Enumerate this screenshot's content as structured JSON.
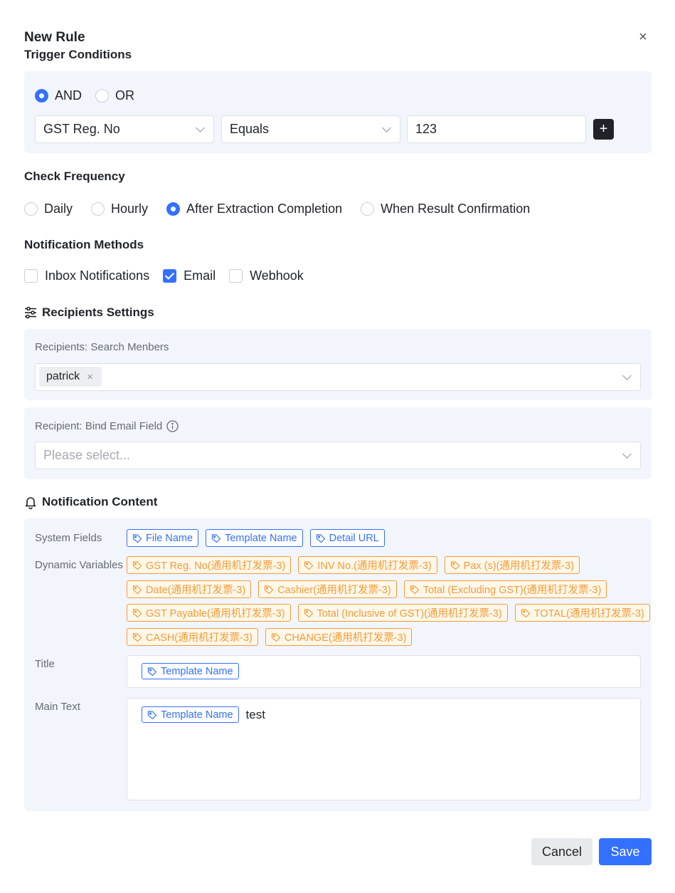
{
  "dialog": {
    "title": "New Rule",
    "close_glyph": "×"
  },
  "trigger": {
    "heading": "Trigger Conditions",
    "logic": [
      {
        "label": "AND",
        "checked": true
      },
      {
        "label": "OR",
        "checked": false
      }
    ],
    "field_value": "GST Reg. No",
    "operator_value": "Equals",
    "input_value": "123",
    "add_glyph": "+"
  },
  "frequency": {
    "heading": "Check Frequency",
    "options": [
      {
        "label": "Daily",
        "checked": false
      },
      {
        "label": "Hourly",
        "checked": false
      },
      {
        "label": "After Extraction Completion",
        "checked": true
      },
      {
        "label": "When Result Confirmation",
        "checked": false
      }
    ]
  },
  "methods": {
    "heading": "Notification Methods",
    "options": [
      {
        "label": "Inbox Notifications",
        "checked": false
      },
      {
        "label": "Email",
        "checked": true
      },
      {
        "label": "Webhook",
        "checked": false
      }
    ]
  },
  "recipients": {
    "heading": "Recipients Settings",
    "search_label": "Recipients: Search Menbers",
    "selected": [
      "patrick"
    ],
    "remove_glyph": "×",
    "bind_label": "Recipient: Bind Email Field",
    "bind_placeholder": "Please select..."
  },
  "content": {
    "heading": "Notification Content",
    "system_fields_label": "System Fields",
    "system_fields": [
      "File Name",
      "Template Name",
      "Detail URL"
    ],
    "dynamic_label": "Dynamic Variables",
    "dynamic_rows": [
      [
        "GST Reg. No(通用机打发票-3)",
        "INV No.(通用机打发票-3)",
        "Pax (s)(通用机打发票-3)"
      ],
      [
        "Date(通用机打发票-3)",
        "Cashier(通用机打发票-3)",
        "Total (Excluding GST)(通用机打发票-3)"
      ],
      [
        "GST Payable(通用机打发票-3)",
        "Total (Inclusive of GST)(通用机打发票-3)",
        "TOTAL(通用机打发票-3)"
      ],
      [
        "CASH(通用机打发票-3)",
        "CHANGE(通用机打发票-3)"
      ]
    ],
    "title_label": "Title",
    "title_tag": "Template Name",
    "main_label": "Main Text",
    "main_tag": "Template Name",
    "main_text": "test"
  },
  "footer": {
    "cancel_label": "Cancel",
    "save_label": "Save"
  },
  "colors": {
    "accent": "#3370ff",
    "variable": "#f39c35",
    "panel": "#f2f5fc"
  }
}
